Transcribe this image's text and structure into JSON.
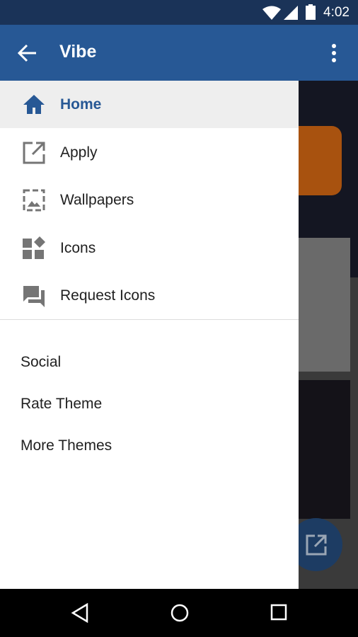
{
  "status_bar": {
    "time": "4:02",
    "icons": [
      "wifi-icon",
      "signal-icon",
      "battery-icon"
    ]
  },
  "app_bar": {
    "title": "Vibe",
    "back_icon": "arrow-back-icon",
    "menu_icon": "more-vert-icon"
  },
  "drawer": {
    "items": [
      {
        "label": "Home",
        "icon": "home-icon",
        "active": true
      },
      {
        "label": "Apply",
        "icon": "open-in-new-icon"
      },
      {
        "label": "Wallpapers",
        "icon": "image-icon"
      },
      {
        "label": "Icons",
        "icon": "widgets-icon"
      },
      {
        "label": "Request Icons",
        "icon": "forum-icon"
      }
    ],
    "secondary": [
      {
        "label": "Social"
      },
      {
        "label": "Rate Theme"
      },
      {
        "label": "More Themes"
      }
    ]
  },
  "colors": {
    "primary": "#275895",
    "status": "#1a3358",
    "active_bg": "#eeeeee"
  },
  "nav_bar": {
    "icons": [
      "back-icon",
      "home-circle-icon",
      "recents-icon"
    ]
  }
}
